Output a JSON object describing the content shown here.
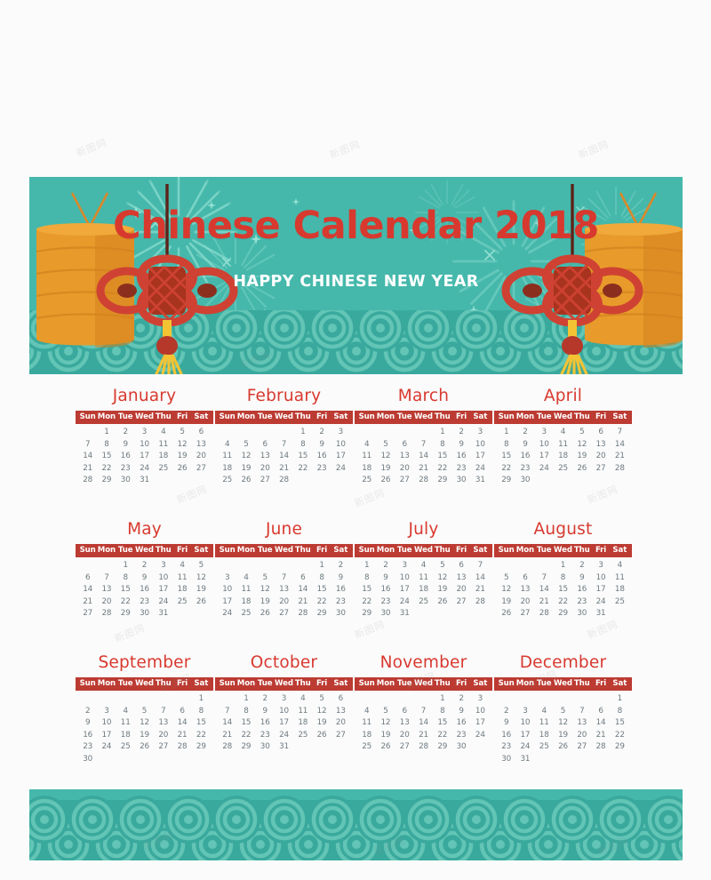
{
  "page": {
    "background_color": "#fbfbfb",
    "watermark_text": "新图网"
  },
  "header": {
    "title": "Chinese Calendar 2018",
    "subtitle": "HAPPY CHINESE NEW YEAR",
    "background_color": "#45b8ab",
    "title_color": "#d8392f",
    "subtitle_color": "#ffffff",
    "decorations": {
      "left_lantern": "lantern-icon",
      "right_lantern": "lantern-icon",
      "left_knot": "chinese-knot-icon",
      "right_knot": "chinese-knot-icon",
      "fireworks": "fireworks-icon",
      "waves": "wave-pattern-icon"
    }
  },
  "footer": {
    "background_color": "#45b8ab",
    "pattern": "wave-pattern-icon"
  },
  "calendar": {
    "year": "2018",
    "weekday_header_color": "#bc3b32",
    "month_title_color": "#d8392f",
    "day_text_color": "#6e7a80",
    "weekdays": [
      "Sun",
      "Mon",
      "Tue",
      "Wed",
      "Thu",
      "Fri",
      "Sat"
    ],
    "months": [
      {
        "name": "January",
        "weeks": [
          [
            "",
            "1",
            "2",
            "3",
            "4",
            "5",
            "6"
          ],
          [
            "7",
            "8",
            "9",
            "10",
            "11",
            "12",
            "13"
          ],
          [
            "14",
            "15",
            "16",
            "17",
            "18",
            "19",
            "20"
          ],
          [
            "21",
            "22",
            "23",
            "24",
            "25",
            "26",
            "27"
          ],
          [
            "28",
            "29",
            "30",
            "31",
            "",
            "",
            ""
          ]
        ]
      },
      {
        "name": "February",
        "weeks": [
          [
            "",
            "",
            "",
            "",
            "1",
            "2",
            "3"
          ],
          [
            "4",
            "5",
            "6",
            "7",
            "8",
            "9",
            "10"
          ],
          [
            "11",
            "12",
            "13",
            "14",
            "15",
            "16",
            "17"
          ],
          [
            "18",
            "19",
            "20",
            "21",
            "22",
            "23",
            "24"
          ],
          [
            "25",
            "26",
            "27",
            "28",
            "",
            "",
            ""
          ]
        ]
      },
      {
        "name": "March",
        "weeks": [
          [
            "",
            "",
            "",
            "",
            "1",
            "2",
            "3"
          ],
          [
            "4",
            "5",
            "6",
            "7",
            "8",
            "9",
            "10"
          ],
          [
            "11",
            "12",
            "13",
            "14",
            "15",
            "16",
            "17"
          ],
          [
            "18",
            "19",
            "20",
            "21",
            "22",
            "23",
            "24"
          ],
          [
            "25",
            "26",
            "27",
            "28",
            "29",
            "30",
            "31"
          ]
        ]
      },
      {
        "name": "April",
        "weeks": [
          [
            "1",
            "2",
            "3",
            "4",
            "5",
            "6",
            "7"
          ],
          [
            "8",
            "9",
            "10",
            "11",
            "12",
            "13",
            "14"
          ],
          [
            "15",
            "16",
            "17",
            "18",
            "19",
            "20",
            "21"
          ],
          [
            "22",
            "23",
            "24",
            "25",
            "26",
            "27",
            "28"
          ],
          [
            "29",
            "30",
            "",
            "",
            "",
            "",
            ""
          ]
        ]
      },
      {
        "name": "May",
        "weeks": [
          [
            "",
            "",
            "1",
            "2",
            "3",
            "4",
            "5"
          ],
          [
            "6",
            "7",
            "8",
            "9",
            "10",
            "11",
            "12"
          ],
          [
            "14",
            "13",
            "15",
            "16",
            "17",
            "18",
            "19"
          ],
          [
            "21",
            "20",
            "22",
            "23",
            "24",
            "25",
            "26"
          ],
          [
            "27",
            "28",
            "29",
            "30",
            "31",
            "",
            ""
          ]
        ]
      },
      {
        "name": "June",
        "weeks": [
          [
            "",
            "",
            "",
            "",
            "",
            "1",
            "2"
          ],
          [
            "3",
            "4",
            "5",
            "7",
            "6",
            "8",
            "9"
          ],
          [
            "10",
            "11",
            "12",
            "13",
            "14",
            "15",
            "16"
          ],
          [
            "17",
            "18",
            "19",
            "20",
            "21",
            "22",
            "23"
          ],
          [
            "24",
            "25",
            "26",
            "27",
            "28",
            "29",
            "30"
          ]
        ]
      },
      {
        "name": "July",
        "weeks": [
          [
            "1",
            "2",
            "3",
            "4",
            "5",
            "6",
            "7"
          ],
          [
            "8",
            "9",
            "10",
            "11",
            "12",
            "13",
            "14"
          ],
          [
            "15",
            "16",
            "17",
            "18",
            "19",
            "20",
            "21"
          ],
          [
            "22",
            "23",
            "24",
            "25",
            "26",
            "27",
            "28"
          ],
          [
            "29",
            "30",
            "31",
            "",
            "",
            "",
            ""
          ]
        ]
      },
      {
        "name": "August",
        "weeks": [
          [
            "",
            "",
            "",
            "1",
            "2",
            "3",
            "4"
          ],
          [
            "5",
            "6",
            "7",
            "8",
            "9",
            "10",
            "11"
          ],
          [
            "12",
            "13",
            "14",
            "15",
            "16",
            "17",
            "18"
          ],
          [
            "19",
            "20",
            "21",
            "22",
            "23",
            "24",
            "25"
          ],
          [
            "26",
            "27",
            "28",
            "29",
            "30",
            "31",
            ""
          ]
        ]
      },
      {
        "name": "September",
        "weeks": [
          [
            "",
            "",
            "",
            "",
            "",
            "",
            "1"
          ],
          [
            "2",
            "3",
            "4",
            "5",
            "7",
            "6",
            "8"
          ],
          [
            "9",
            "10",
            "11",
            "12",
            "13",
            "14",
            "15"
          ],
          [
            "16",
            "17",
            "18",
            "19",
            "20",
            "21",
            "22"
          ],
          [
            "23",
            "24",
            "25",
            "26",
            "27",
            "28",
            "29"
          ],
          [
            "30",
            "",
            "",
            "",
            "",
            "",
            ""
          ]
        ]
      },
      {
        "name": "October",
        "weeks": [
          [
            "",
            "1",
            "2",
            "3",
            "4",
            "5",
            "6"
          ],
          [
            "7",
            "8",
            "9",
            "10",
            "11",
            "12",
            "13"
          ],
          [
            "14",
            "15",
            "16",
            "17",
            "18",
            "19",
            "20"
          ],
          [
            "21",
            "22",
            "23",
            "24",
            "25",
            "26",
            "27"
          ],
          [
            "28",
            "29",
            "30",
            "31",
            "",
            "",
            ""
          ]
        ]
      },
      {
        "name": "November",
        "weeks": [
          [
            "",
            "",
            "",
            "",
            "1",
            "2",
            "3"
          ],
          [
            "4",
            "5",
            "6",
            "7",
            "8",
            "9",
            "10"
          ],
          [
            "11",
            "12",
            "13",
            "14",
            "15",
            "16",
            "17"
          ],
          [
            "18",
            "19",
            "20",
            "21",
            "22",
            "23",
            "24"
          ],
          [
            "25",
            "26",
            "27",
            "28",
            "29",
            "30",
            ""
          ]
        ]
      },
      {
        "name": "December",
        "weeks": [
          [
            "",
            "",
            "",
            "",
            "",
            "",
            "1"
          ],
          [
            "2",
            "3",
            "4",
            "5",
            "7",
            "6",
            "8"
          ],
          [
            "9",
            "10",
            "11",
            "12",
            "13",
            "14",
            "15"
          ],
          [
            "16",
            "17",
            "18",
            "19",
            "20",
            "21",
            "22"
          ],
          [
            "23",
            "24",
            "25",
            "26",
            "27",
            "28",
            "29"
          ],
          [
            "30",
            "31",
            "",
            "",
            "",
            "",
            ""
          ]
        ]
      }
    ]
  }
}
